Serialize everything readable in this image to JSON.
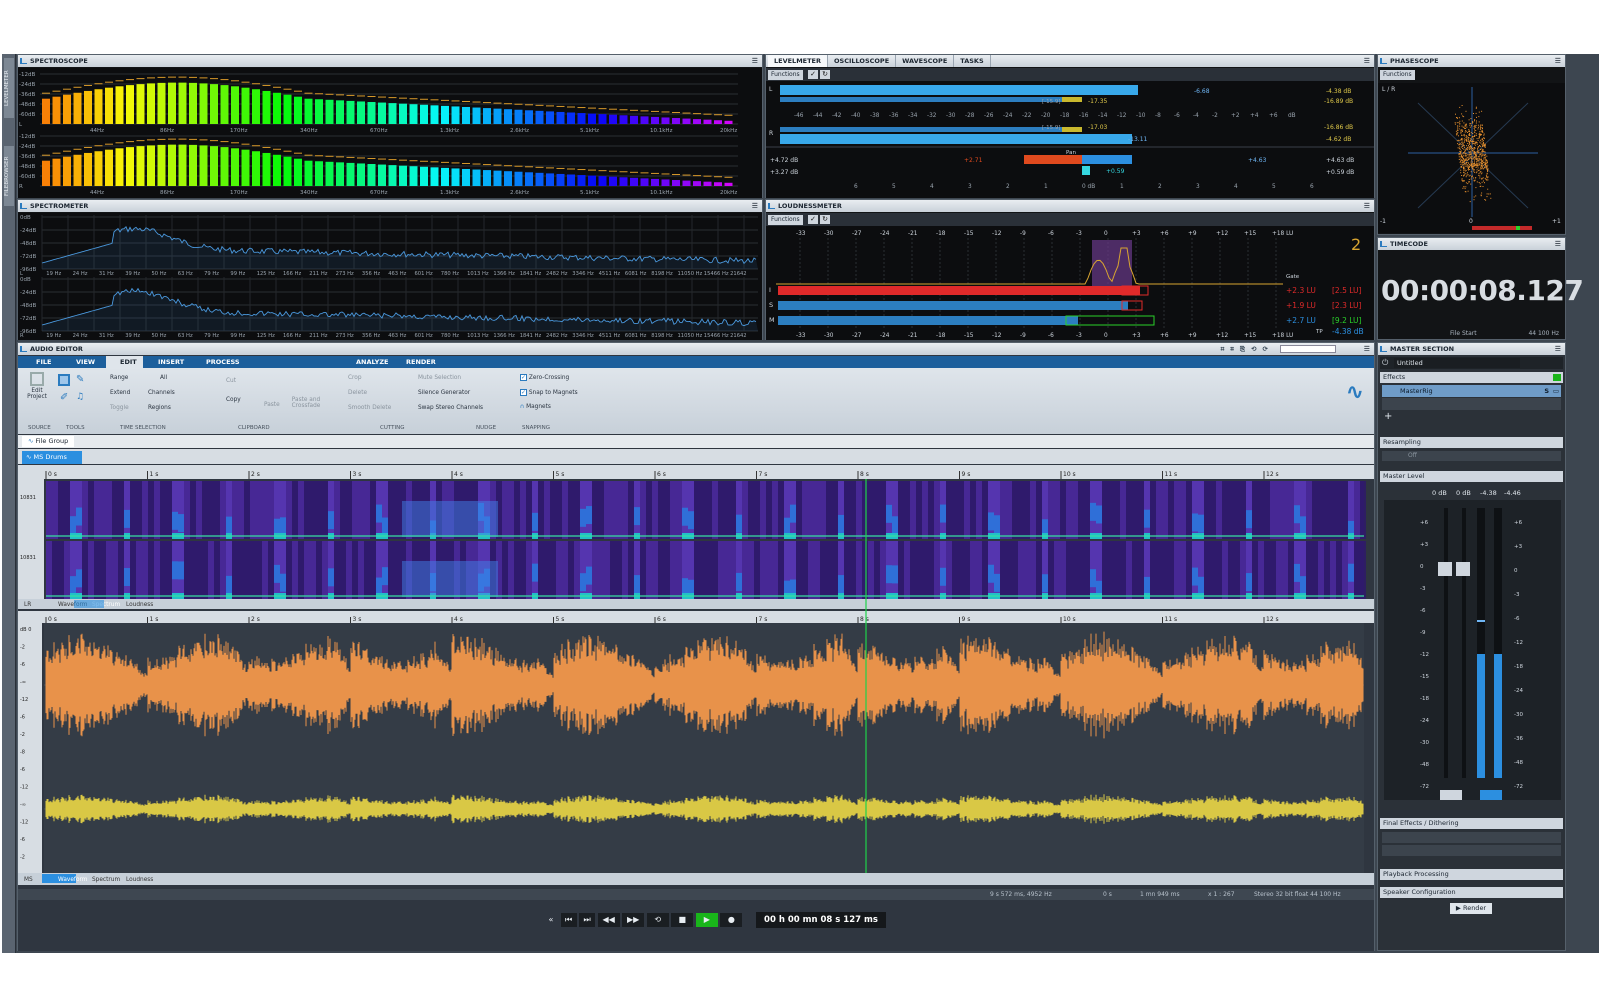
{
  "left_strip": {
    "labels": [
      "LEVELMETER",
      "FILEBROWSER"
    ]
  },
  "spectroscope": {
    "title": "SPECTROSCOPE",
    "db_ticks": [
      "-12dB",
      "-24dB",
      "-36dB",
      "-48dB",
      "-60dB",
      "L",
      "-12dB",
      "-24dB",
      "-36dB",
      "-48dB",
      "-60dB",
      "R"
    ],
    "freq_ticks": [
      "44Hz",
      "86Hz",
      "170Hz",
      "340Hz",
      "670Hz",
      "1.3kHz",
      "2.6kHz",
      "5.1kHz",
      "10.1kHz",
      "20kHz"
    ]
  },
  "spectrometer": {
    "title": "SPECTROMETER",
    "db_ticks": [
      "0dB",
      "-24dB",
      "-48dB",
      "-72dB",
      "-96dB"
    ],
    "freq_ticks": [
      "L",
      "19 Hz",
      "24 Hz",
      "31 Hz",
      "39 Hz",
      "50 Hz",
      "63 Hz",
      "79 Hz",
      "99 Hz",
      "125 Hz",
      "166 Hz",
      "211 Hz",
      "273 Hz",
      "356 Hz",
      "463 Hz",
      "601 Hz",
      "780 Hz",
      "1013 Hz",
      "1366 Hz",
      "1841 Hz",
      "2482 Hz",
      "3346 Hz",
      "4511 Hz",
      "6081 Hz",
      "8198 Hz",
      "11050 Hz",
      "15466 Hz",
      "21642"
    ],
    "freq_ticks_r": [
      "R",
      "19 Hz",
      "24 Hz",
      "31 Hz",
      "39 Hz",
      "50 Hz",
      "63 Hz",
      "79 Hz",
      "99 Hz",
      "125 Hz",
      "166 Hz",
      "211 Hz",
      "273 Hz",
      "356 Hz",
      "463 Hz",
      "601 Hz",
      "780 Hz",
      "1013 Hz",
      "1366 Hz",
      "1841 Hz",
      "2482 Hz",
      "3346 Hz",
      "4511 Hz",
      "6081 Hz",
      "8198 Hz",
      "11050 Hz",
      "15466 Hz",
      "21642"
    ]
  },
  "levelmeter": {
    "tabs": [
      "LEVELMETER",
      "OSCILLOSCOPE",
      "WAVESCOPE",
      "TASKS"
    ],
    "functions": "Functions",
    "L": "L",
    "R": "R",
    "l_peak": "-4.38 dB",
    "l_rms": "-16.89 dB",
    "r_peak": "-4.62 dB",
    "r_rms": "-16.86 dB",
    "l_bar_val": "-6.68",
    "l_rms_val": "-17.35",
    "r_rms_val": "-17.03",
    "r_bar_val": "-13.11",
    "rms_l_box": "[-15.9]",
    "rms_r_box": "[-15.9]",
    "scale": [
      "-46",
      "-44",
      "-42",
      "-40",
      "-38",
      "-36",
      "-34",
      "-32",
      "-30",
      "-28",
      "-26",
      "-24",
      "-22",
      "-20",
      "-18",
      "-16",
      "-14",
      "-12",
      "-10",
      "-8",
      "-6",
      "-4",
      "-2",
      "+2",
      "+4",
      "+6",
      "dB"
    ],
    "pan_label": "Pan",
    "pan_left_hi": "+4.72 dB",
    "pan_left_lo": "+3.27 dB",
    "pan_right_hi": "+4.63 dB",
    "pan_right_lo": "+0.59 dB",
    "pan_neg": "+2.71",
    "pan_pos": "+4.63",
    "pan_center": "+0.59",
    "pan_scale": [
      "6",
      "5",
      "4",
      "3",
      "2",
      "1",
      "0 dB",
      "1",
      "2",
      "3",
      "4",
      "5",
      "6"
    ]
  },
  "loudness": {
    "title": "LOUDNESSMETER",
    "functions": "Functions",
    "scale": [
      "-33",
      "-30",
      "-27",
      "-24",
      "-21",
      "-18",
      "-15",
      "-12",
      "-9",
      "-6",
      "-3",
      "0",
      "+3",
      "+6",
      "+9",
      "+12",
      "+15",
      "+18 LU"
    ],
    "rows": [
      "I",
      "S",
      "M"
    ],
    "gate": "Gate",
    "i_val": "+2.3 LU",
    "i_max": "[2.5 LU]",
    "s_val": "+1.9 LU",
    "s_max": "[2.3 LU]",
    "m_val": "+2.7 LU",
    "m_max": "[9.2 LU]",
    "tp": "TP",
    "tp_val": "-4.38 dB"
  },
  "phasescope": {
    "title": "PHASESCOPE",
    "functions": "Functions",
    "lr": "L / R",
    "min": "-1",
    "zero": "0",
    "max": "+1"
  },
  "timecode": {
    "title": "TIMECODE",
    "value": "00:00:08.127",
    "mode": "File Start",
    "rate": "44 100 Hz"
  },
  "audio_editor": {
    "title": "AUDIO EDITOR",
    "ribbon_tabs": [
      "FILE",
      "VIEW",
      "EDIT",
      "INSERT",
      "PROCESS",
      "ANALYZE",
      "RENDER"
    ],
    "groups": {
      "source": "SOURCE",
      "tools": "TOOLS",
      "time_selection": "TIME SELECTION",
      "clipboard": "CLIPBOARD",
      "cutting": "CUTTING",
      "nudge": "NUDGE",
      "snapping": "SNAPPING"
    },
    "buttons": {
      "edit_project": "Edit Project",
      "range": "Range",
      "all": "All",
      "extend": "Extend",
      "channels": "Channels",
      "toggle": "Toggle",
      "regions": "Regions",
      "cut": "Cut",
      "copy": "Copy",
      "paste": "Paste",
      "paste_crossfade": "Paste and Crossfade",
      "crop": "Crop",
      "delete": "Delete",
      "smooth_delete": "Smooth Delete",
      "mute_selection": "Mute Selection",
      "silence_generator": "Silence Generator",
      "swap_stereo": "Swap Stereo Channels",
      "zero_crossing": "Zero-Crossing",
      "snap_magnets": "Snap to Magnets",
      "magnets": "Magnets"
    },
    "file_group": "File Group",
    "file_tab": "MS Drums",
    "ruler": [
      "0 s",
      "1 s",
      "2 s",
      "3 s",
      "4 s",
      "5 s",
      "6 s",
      "7 s",
      "8 s",
      "9 s",
      "10 s",
      "11 s",
      "12 s"
    ],
    "freq_tick": "10831",
    "spec_tab_bar": [
      "LR",
      "Waveform",
      "Spectrum",
      "Loudness"
    ],
    "wave_tab_bar": [
      "MS",
      "Waveform",
      "Spectrum",
      "Loudness"
    ],
    "db_ticks": [
      "dB 0",
      "-2",
      "-6",
      "-∞",
      "-12",
      "-6",
      "-2",
      "-8",
      "-6",
      "-12",
      "-∞",
      "-12",
      "-6",
      "-2"
    ],
    "status": {
      "sel": "9 s 572 ms, 4952 Hz",
      "start": "0 s",
      "len": "1 mn 949 ms",
      "zoom": "x 1 : 267",
      "format": "Stereo 32 bit float 44 100 Hz"
    },
    "transport_time": "00 h 00 mn 08 s 127 ms"
  },
  "master_section": {
    "title": "MASTER SECTION",
    "preset": "Untitled",
    "effects": "Effects",
    "rig": "MasterRig",
    "resampling": "Resampling",
    "off": "Off",
    "master_level": "Master Level",
    "levels": [
      "0 dB",
      "0 dB",
      "-4.38",
      "-4.46"
    ],
    "scale_l": [
      "+6",
      "+3",
      "0",
      "-3",
      "-6",
      "-9",
      "-12",
      "-15",
      "-18",
      "-24",
      "-30",
      "-48",
      "-72"
    ],
    "scale_r": [
      "+6",
      "+3",
      "0",
      "-3",
      "-6",
      "-12",
      "-18",
      "-24",
      "-30",
      "-36",
      "-48",
      "-72"
    ],
    "final_effects": "Final Effects / Dithering",
    "playback": "Playback Processing",
    "speaker": "Speaker Configuration",
    "render": "Render"
  },
  "colors": {
    "wave_mid": "#e8924a",
    "wave_side": "#d9c845",
    "accent": "#2b7bbf",
    "play": "#19b51a",
    "cursor": "#1fd34a"
  }
}
